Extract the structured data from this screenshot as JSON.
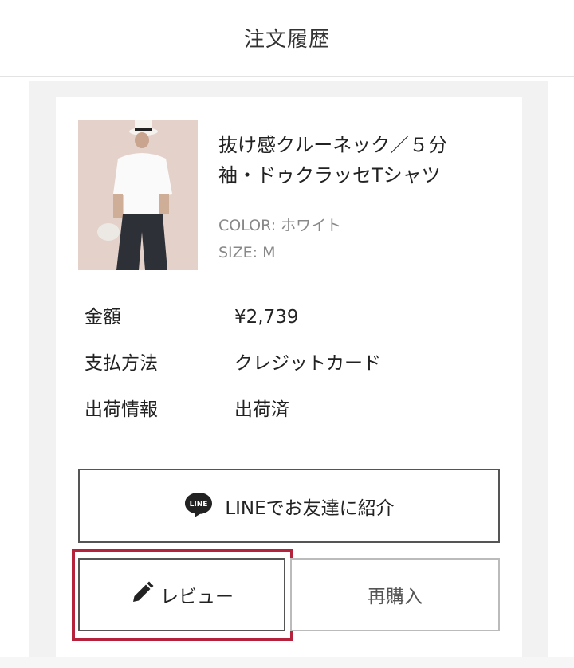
{
  "header": {
    "title": "注文履歴"
  },
  "order": {
    "product": {
      "name_line1": "抜け感クルーネック／５分",
      "name_line2": "袖・ドゥクラッセTシャツ",
      "color": "COLOR: ホワイト",
      "size": "SIZE: M",
      "image": "product-photo"
    },
    "details": [
      {
        "label": "金額",
        "value": "¥2,739"
      },
      {
        "label": "支払方法",
        "value": "クレジットカード"
      },
      {
        "label": "出荷情報",
        "value": "出荷済"
      }
    ],
    "actions": {
      "line_share": {
        "label": "LINEでお友達に紹介",
        "icon": "line-logo-icon",
        "icon_text": "LINE"
      },
      "review": {
        "label": "レビュー",
        "icon": "pencil-icon"
      },
      "rebuy": {
        "label": "再購入"
      }
    }
  },
  "colors": {
    "highlight": "#b5223b",
    "line_icon": "#222222"
  }
}
